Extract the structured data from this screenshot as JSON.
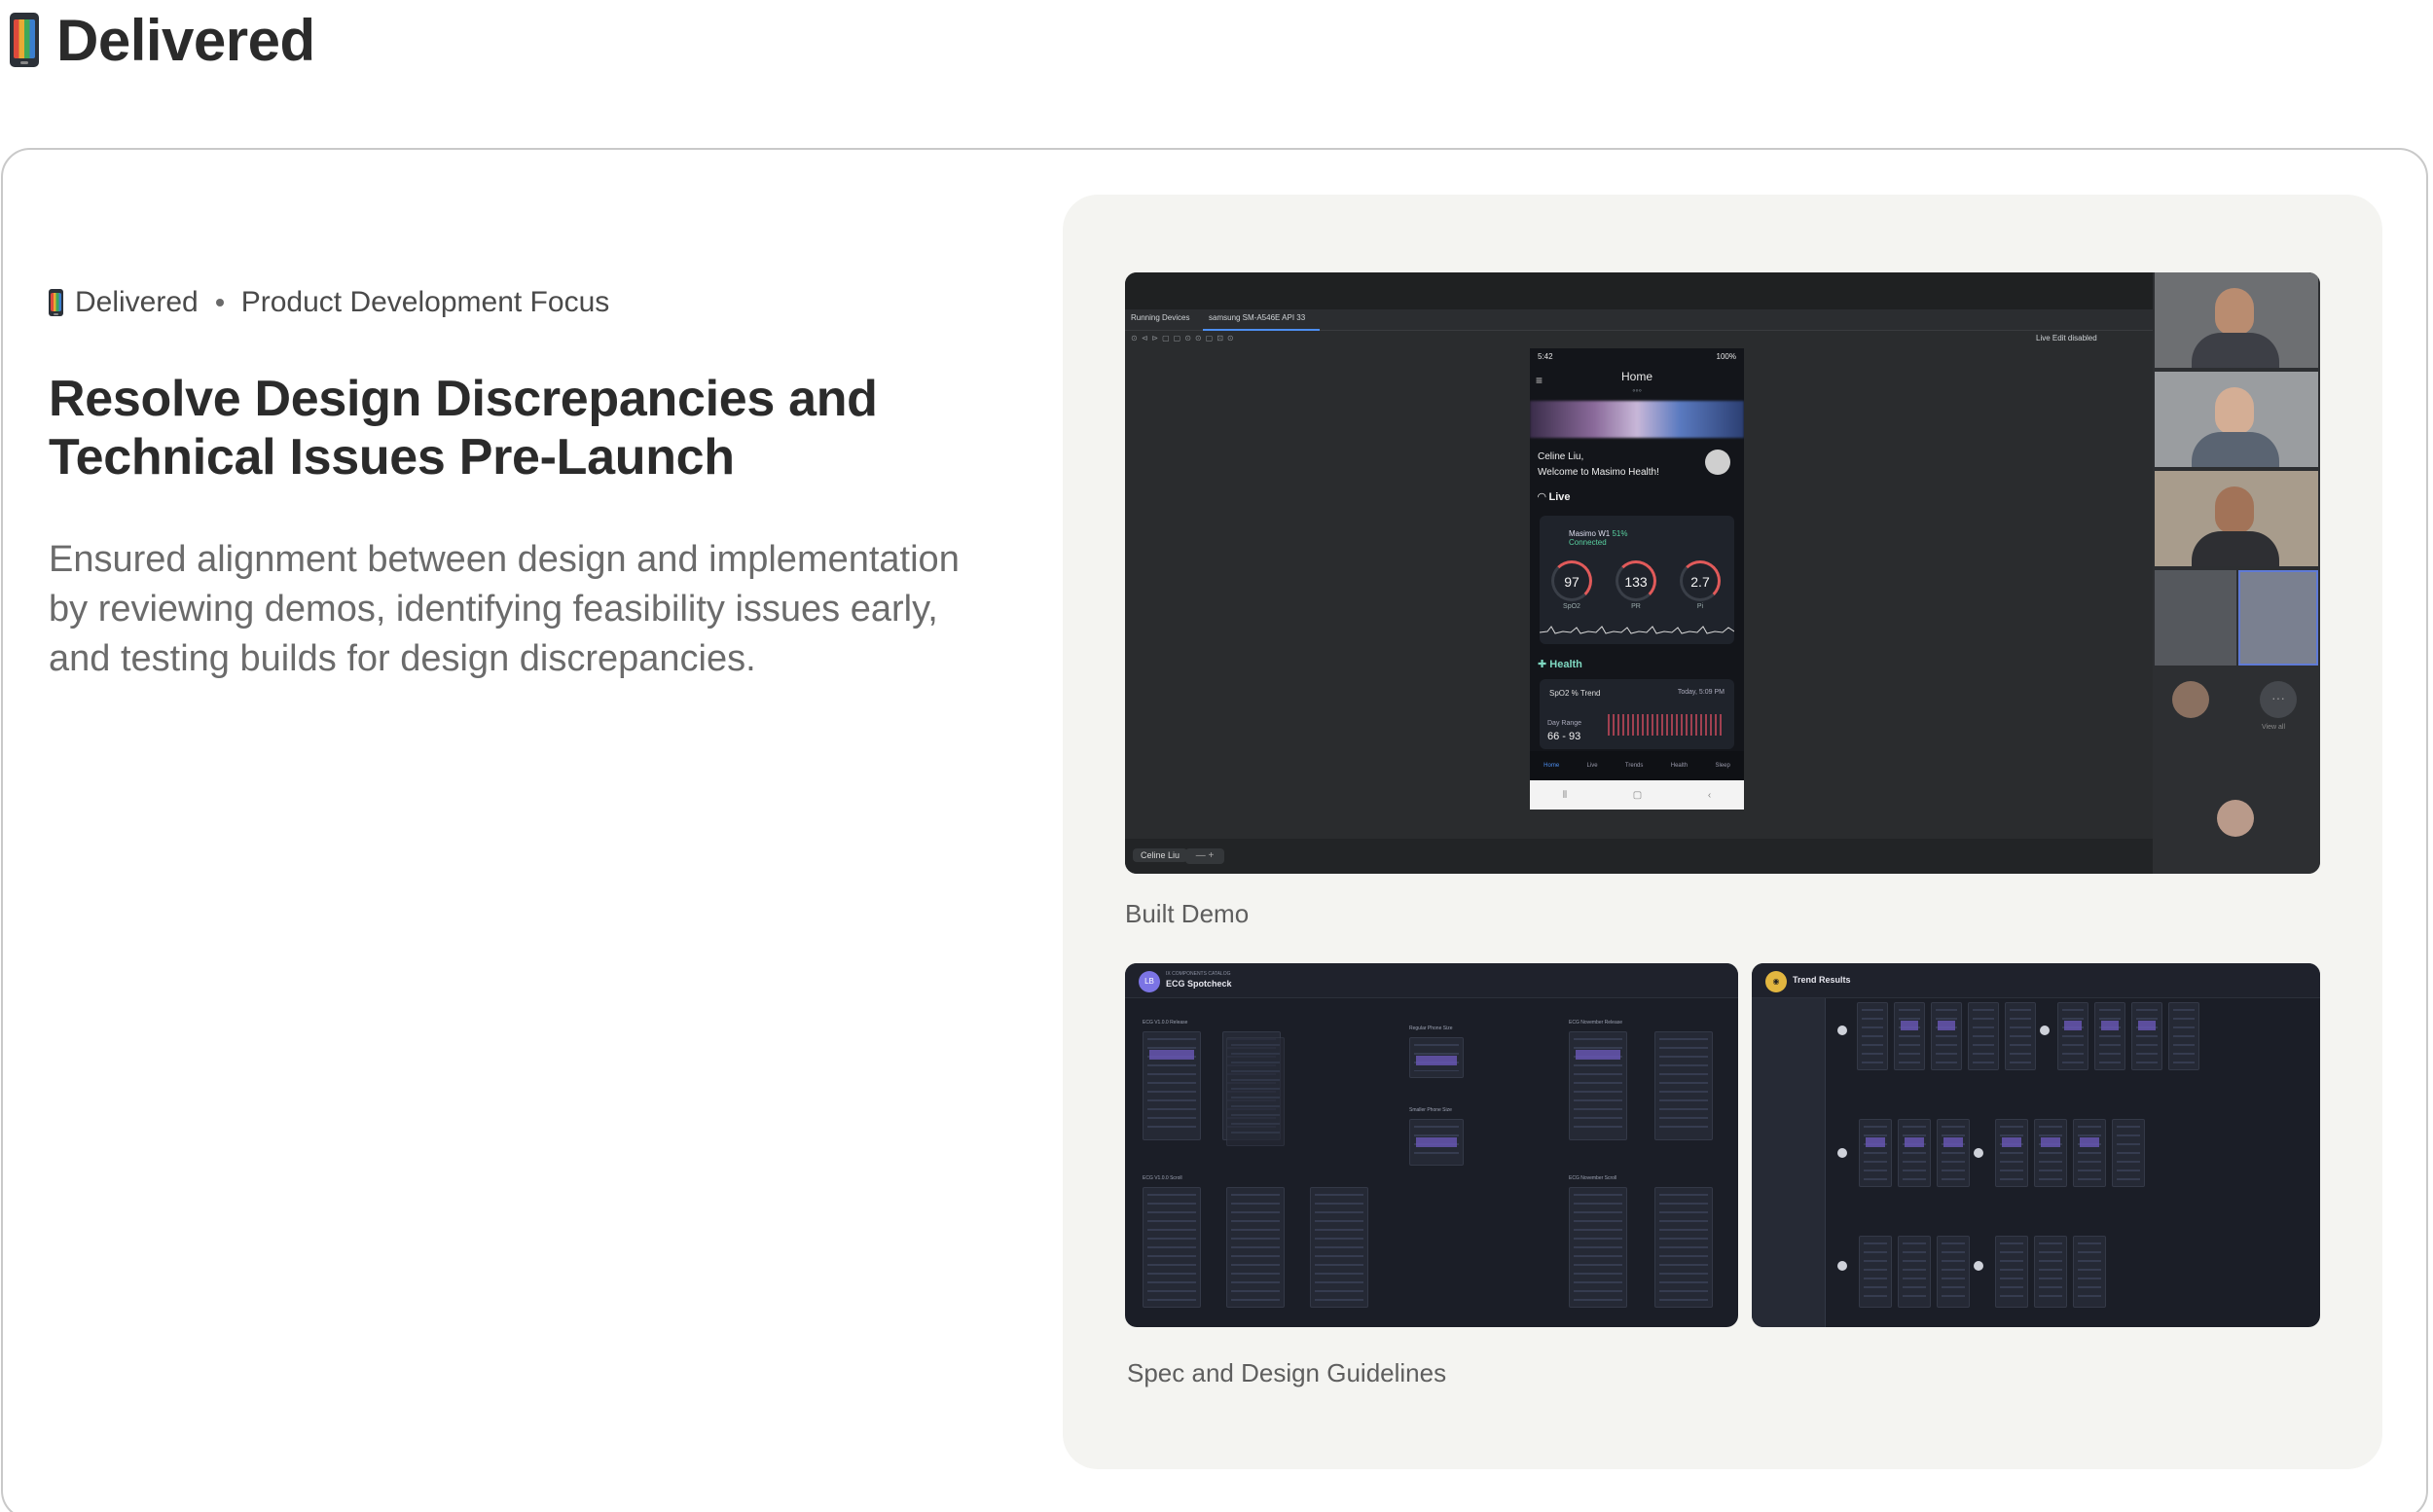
{
  "page": {
    "title": "Delivered"
  },
  "card": {
    "meta_status": "Delivered",
    "meta_focus": "Product Development Focus",
    "headline": "Resolve Design Discrepancies and Technical Issues Pre-Launch",
    "description": "Ensured alignment between design and implementation by reviewing demos, identifying feasibility issues early, and testing builds for design discrepancies."
  },
  "media": {
    "demo_caption": "Built Demo",
    "spec_caption": "Spec and Design Guidelines",
    "demo": {
      "tab_running": "Running Devices",
      "tab_device": "samsung SM-A546E API 33",
      "live_edit": "Live Edit disabled",
      "participant": "Celine Liu",
      "phone": {
        "time": "5:42",
        "battery": "100%",
        "title": "Home",
        "greeting_line1": "Celine Liu,",
        "greeting_line2": "Welcome to Masimo Health!",
        "section_live": "Live",
        "device_name": "Masimo W1",
        "device_battery": "51%",
        "device_status": "Connected",
        "gauges": [
          {
            "value": "97",
            "label": "SpO2"
          },
          {
            "value": "133",
            "label": "PR"
          },
          {
            "value": "2.7",
            "label": "Pi"
          }
        ],
        "section_health": "Health",
        "trend_label": "SpO2 % Trend",
        "trend_time": "Today, 5:09 PM",
        "range_label": "Day Range",
        "range_value": "66 - 93",
        "nav": [
          "Home",
          "Live",
          "Trends",
          "Health",
          "Sleep"
        ]
      },
      "video_tiles": {
        "view_all": "View all"
      }
    },
    "spec_left": {
      "badge": "LB",
      "subtitle": "IX COMPONENTS CATALOG",
      "title": "ECG Spotcheck",
      "labels": [
        "ECG V1.0.0 Release",
        "ECG V1.0.0 Scroll",
        "Regular Phone Size",
        "Smaller Phone Size",
        "ECG November Release",
        "ECG November Scroll"
      ]
    },
    "spec_right": {
      "title": "Trend Results"
    }
  },
  "colors": {
    "card_border": "#c9c9c9",
    "panel_bg": "#f4f4f1",
    "accent_blue": "#4d8ef0"
  }
}
